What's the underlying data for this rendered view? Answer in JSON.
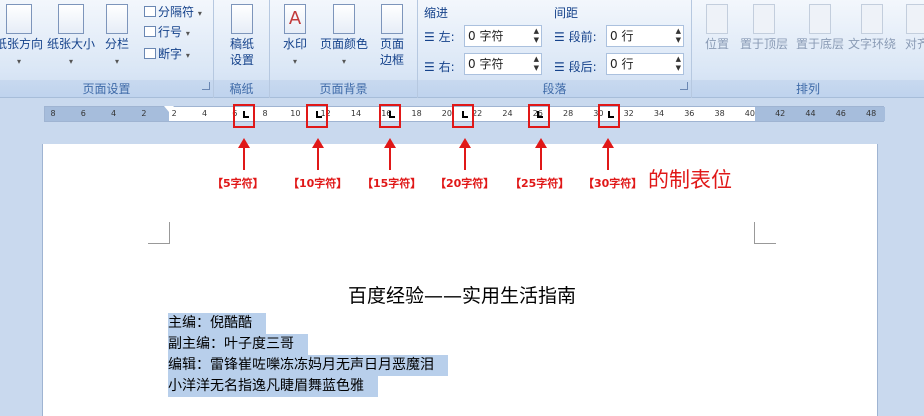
{
  "ribbon": {
    "groups": {
      "page_setup": {
        "label": "页面设置",
        "orientation": "纸张方向",
        "size": "纸张大小",
        "columns": "分栏",
        "breaks": "分隔符",
        "line_numbers": "行号",
        "hyphenation": "断字"
      },
      "manuscript": {
        "label": "稿纸",
        "settings_line1": "稿纸",
        "settings_line2": "设置"
      },
      "page_background": {
        "label": "页面背景",
        "watermark": "水印",
        "page_color": "页面颜色",
        "page_borders_line1": "页面",
        "page_borders_line2": "边框"
      },
      "paragraph": {
        "label": "段落",
        "indent": "缩进",
        "spacing": "间距",
        "indent_left_label": "左:",
        "indent_left_value": "0 字符",
        "indent_right_label": "右:",
        "indent_right_value": "0 字符",
        "spacing_before_label": "段前:",
        "spacing_before_value": "0 行",
        "spacing_after_label": "段后:",
        "spacing_after_value": "0 行"
      },
      "arrange": {
        "label": "排列",
        "position": "位置",
        "bring_front": "置于顶层",
        "send_back": "置于底层",
        "text_wrap": "文字环绕",
        "align": "对齐"
      }
    }
  },
  "ruler": {
    "ticks": [
      "8",
      "6",
      "4",
      "2",
      "2",
      "4",
      "6",
      "8",
      "10",
      "12",
      "14",
      "16",
      "18",
      "20",
      "22",
      "24",
      "26",
      "28",
      "30",
      "32",
      "34",
      "36",
      "38",
      "40",
      "42",
      "44",
      "46",
      "48"
    ]
  },
  "annotations": {
    "tab_labels": [
      "【5字符】",
      "【10字符】",
      "【15字符】",
      "【20字符】",
      "【25字符】",
      "【30字符】"
    ],
    "callout": "的制表位"
  },
  "document": {
    "title": "百度经验——实用生活指南",
    "lines": [
      "主编：倪酷酷",
      "副主编：叶子度三哥",
      "编辑：雷锋崔咗嚛冻冻妈月无声日月恶魔泪",
      "小洋洋无名指逸凡睫眉舞蓝色雅"
    ]
  },
  "colors": {
    "annotation_red": "#e01818",
    "selection": "#b8cfeb",
    "ribbon_text": "#15428b"
  }
}
